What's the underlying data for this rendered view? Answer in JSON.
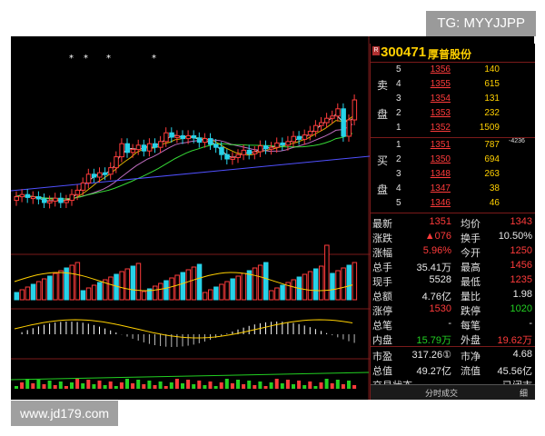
{
  "watermarks": {
    "top": "TG: MYYJJPP",
    "bottom": "www.jd179.com"
  },
  "stock": {
    "badge": "R",
    "code": "300471",
    "name": "厚普股份"
  },
  "orderbook": {
    "sell_label_1": "卖",
    "sell_label_2": "盘",
    "buy_label_1": "买",
    "buy_label_2": "盘",
    "sell": [
      {
        "level": "5",
        "price": "1356",
        "vol": "140"
      },
      {
        "level": "4",
        "price": "1355",
        "vol": "615"
      },
      {
        "level": "3",
        "price": "1354",
        "vol": "131"
      },
      {
        "level": "2",
        "price": "1353",
        "vol": "232"
      },
      {
        "level": "1",
        "price": "1352",
        "vol": "1509"
      }
    ],
    "buy": [
      {
        "level": "1",
        "price": "1351",
        "vol": "787",
        "note": "-4236"
      },
      {
        "level": "2",
        "price": "1350",
        "vol": "694",
        "note": ""
      },
      {
        "level": "3",
        "price": "1348",
        "vol": "263",
        "note": ""
      },
      {
        "level": "4",
        "price": "1347",
        "vol": "38",
        "note": ""
      },
      {
        "level": "5",
        "price": "1346",
        "vol": "46",
        "note": ""
      }
    ]
  },
  "quote": [
    {
      "l1": "最新",
      "v1": "1351",
      "v1c": "red",
      "l2": "均价",
      "v2": "1343",
      "v2c": "red"
    },
    {
      "l1": "涨跌",
      "v1": "▲076",
      "v1c": "red",
      "l2": "换手",
      "v2": "10.50%",
      "v2c": "wht"
    },
    {
      "l1": "涨幅",
      "v1": "5.96%",
      "v1c": "red",
      "l2": "今开",
      "v2": "1250",
      "v2c": "red"
    },
    {
      "l1": "总手",
      "v1": "35.41万",
      "v1c": "wht",
      "l2": "最高",
      "v2": "1456",
      "v2c": "red"
    },
    {
      "l1": "现手",
      "v1": "5528",
      "v1c": "wht",
      "l2": "最低",
      "v2": "1235",
      "v2c": "red"
    },
    {
      "l1": "总额",
      "v1": "4.76亿",
      "v1c": "wht",
      "l2": "量比",
      "v2": "1.98",
      "v2c": "wht"
    },
    {
      "l1": "涨停",
      "v1": "1530",
      "v1c": "red",
      "l2": "跌停",
      "v2": "1020",
      "v2c": "grn"
    },
    {
      "l1": "总笔",
      "v1": "-",
      "v1c": "wht",
      "l2": "每笔",
      "v2": "-",
      "v2c": "wht"
    },
    {
      "l1": "内盘",
      "v1": "15.79万",
      "v1c": "grn",
      "l2": "外盘",
      "v2": "19.62万",
      "v2c": "red"
    }
  ],
  "valuation": [
    {
      "l1": "市盈",
      "v1": "317.26①",
      "v1c": "wht",
      "l2": "市净",
      "v2": "4.68",
      "v2c": "wht"
    },
    {
      "l1": "总值",
      "v1": "49.27亿",
      "v1c": "wht",
      "l2": "流值",
      "v2": "45.56亿",
      "v2c": "wht"
    },
    {
      "l1": "交易状态",
      "v1": "",
      "v1c": "wht",
      "l2": "",
      "v2": "已闭市",
      "v2c": "wht"
    }
  ],
  "tabs": {
    "timeshare": "分时成交",
    "detail": "细"
  },
  "colors": {
    "up": "#ff3b3b",
    "down": "#27d2e8",
    "ma1": "#ffffff",
    "ma2": "#ffd000",
    "ma3": "#e080e0",
    "ma4": "#40ff40",
    "ma5": "#5050ff",
    "frame": "#7a1a1a"
  }
}
